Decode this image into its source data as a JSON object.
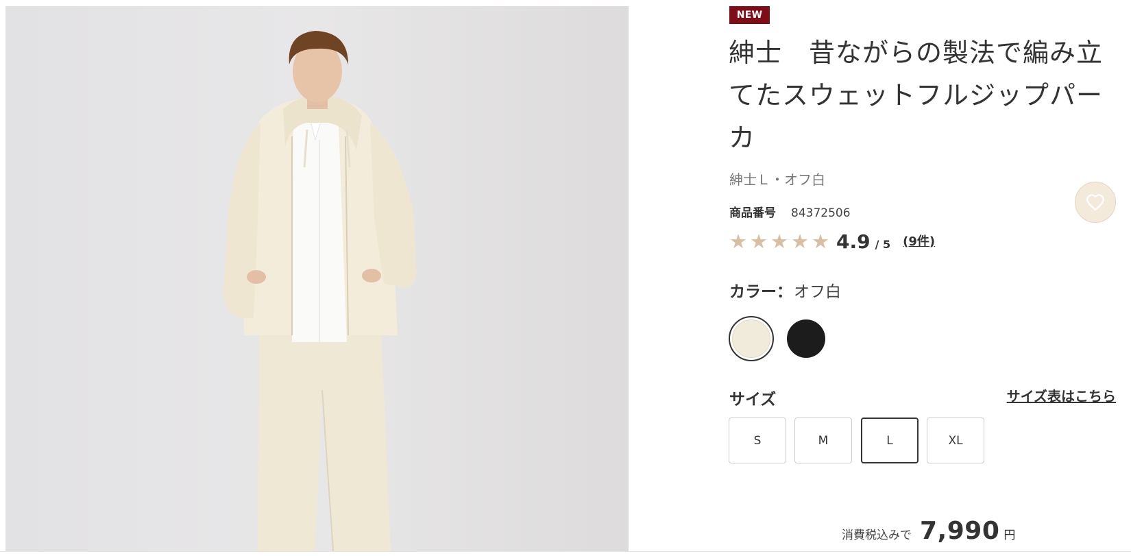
{
  "product": {
    "badge": "NEW",
    "title": "紳士　昔ながらの製法で編み立てたスウェットフルジップパーカ",
    "variant": "紳士Ｌ・オフ白",
    "number_label": "商品番号",
    "number_value": "84372506",
    "image_alt": "product-photo"
  },
  "rating": {
    "score": "4.9",
    "max": "/ 5",
    "count": "(9件)",
    "stars_filled": 5,
    "star_color": "#d7bfa0"
  },
  "wishlist": {
    "icon": "heart-icon"
  },
  "color": {
    "label": "カラー：",
    "selected": "オフ白",
    "swatches": [
      {
        "name": "オフ白",
        "hex": "#f1ebdc",
        "selected": true
      },
      {
        "name": "ブラック",
        "hex": "#1c1c1c",
        "selected": false
      }
    ]
  },
  "size": {
    "label": "サイズ",
    "chart_link": "サイズ表はこちら",
    "options": [
      "S",
      "M",
      "L",
      "XL"
    ],
    "selected": "L"
  },
  "price": {
    "prefix": "消費税込みで",
    "value": "7,990",
    "unit": "円"
  },
  "colors": {
    "badge_bg": "#7f0d17",
    "accent_beige": "#f4eadc",
    "text": "#333333"
  }
}
